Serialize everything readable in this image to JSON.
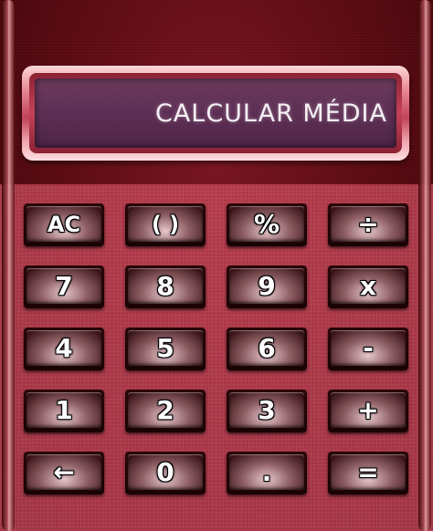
{
  "display": {
    "text": "CALCULAR MÉDIA"
  },
  "keys": [
    {
      "label": "AC"
    },
    {
      "label": "( )"
    },
    {
      "label": "%"
    },
    {
      "label": "÷"
    },
    {
      "label": "7"
    },
    {
      "label": "8"
    },
    {
      "label": "9"
    },
    {
      "label": "x"
    },
    {
      "label": "4"
    },
    {
      "label": "5"
    },
    {
      "label": "6"
    },
    {
      "label": "-"
    },
    {
      "label": "1"
    },
    {
      "label": "2"
    },
    {
      "label": "3"
    },
    {
      "label": "+"
    },
    {
      "label": "←"
    },
    {
      "label": "0"
    },
    {
      "label": "."
    },
    {
      "label": "="
    }
  ],
  "colors": {
    "body": "#5a0a12",
    "panel": "#c04a5c",
    "screen": "#5e2f55",
    "display_text": "#f4f0f4"
  }
}
